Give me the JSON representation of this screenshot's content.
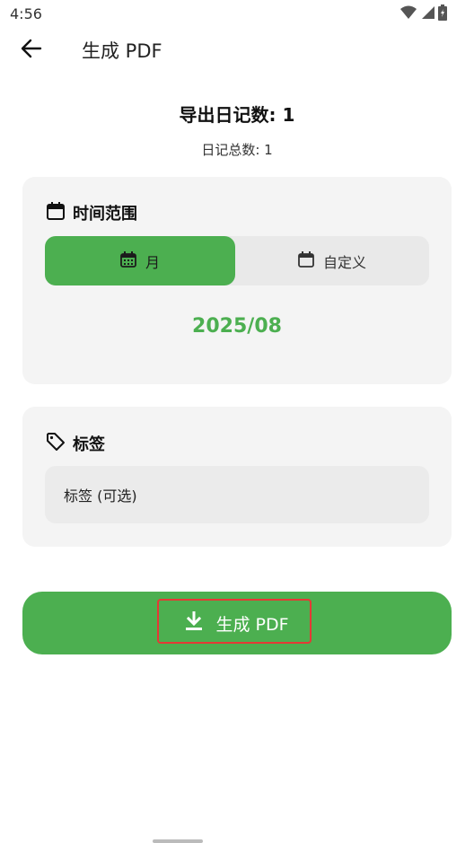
{
  "status_bar": {
    "time": "4:56"
  },
  "app_bar": {
    "title": "生成 PDF"
  },
  "summary": {
    "export_title": "导出日记数: 1",
    "total": "日记总数: 1"
  },
  "range_card": {
    "title": "时间范围",
    "segments": [
      {
        "label": "月",
        "selected": true
      },
      {
        "label": "自定义",
        "selected": false
      }
    ],
    "value": "2025/08"
  },
  "tags_card": {
    "title": "标签",
    "placeholder": "标签 (可选)"
  },
  "generate_button": {
    "label": "生成 PDF"
  },
  "colors": {
    "accent": "#4caf50",
    "card": "#f4f4f4",
    "highlight": "#e53935"
  }
}
